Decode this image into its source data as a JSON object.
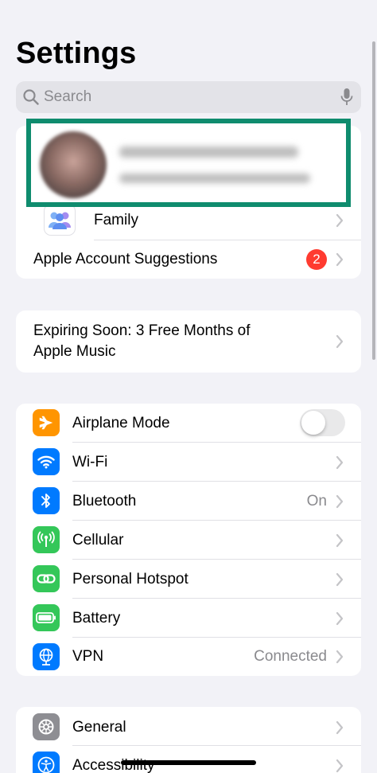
{
  "header": {
    "title": "Settings"
  },
  "search": {
    "placeholder": "Search"
  },
  "account": {
    "family_label": "Family",
    "suggestions_label": "Apple Account Suggestions",
    "suggestions_badge": "2"
  },
  "promo": {
    "line1": "Expiring Soon: 3 Free Months of",
    "line2": "Apple Music"
  },
  "connectivity": {
    "items": [
      {
        "label": "Airplane Mode",
        "icon": "airplane-icon",
        "color": "#ff9500",
        "toggle": false
      },
      {
        "label": "Wi-Fi",
        "icon": "wifi-icon",
        "color": "#007aff",
        "value": ""
      },
      {
        "label": "Bluetooth",
        "icon": "bluetooth-icon",
        "color": "#007aff",
        "value": "On"
      },
      {
        "label": "Cellular",
        "icon": "cellular-icon",
        "color": "#34c759",
        "value": ""
      },
      {
        "label": "Personal Hotspot",
        "icon": "hotspot-icon",
        "color": "#34c759",
        "value": ""
      },
      {
        "label": "Battery",
        "icon": "battery-icon",
        "color": "#34c759",
        "value": ""
      },
      {
        "label": "VPN",
        "icon": "vpn-icon",
        "color": "#007aff",
        "value": "Connected"
      }
    ]
  },
  "system": {
    "items": [
      {
        "label": "General",
        "icon": "gear-icon",
        "color": "#8e8e93"
      },
      {
        "label": "Accessibility",
        "icon": "accessibility-icon",
        "color": "#007aff"
      }
    ]
  },
  "colors": {
    "highlight": "#0f8c6e",
    "badge": "#ff3b30"
  }
}
